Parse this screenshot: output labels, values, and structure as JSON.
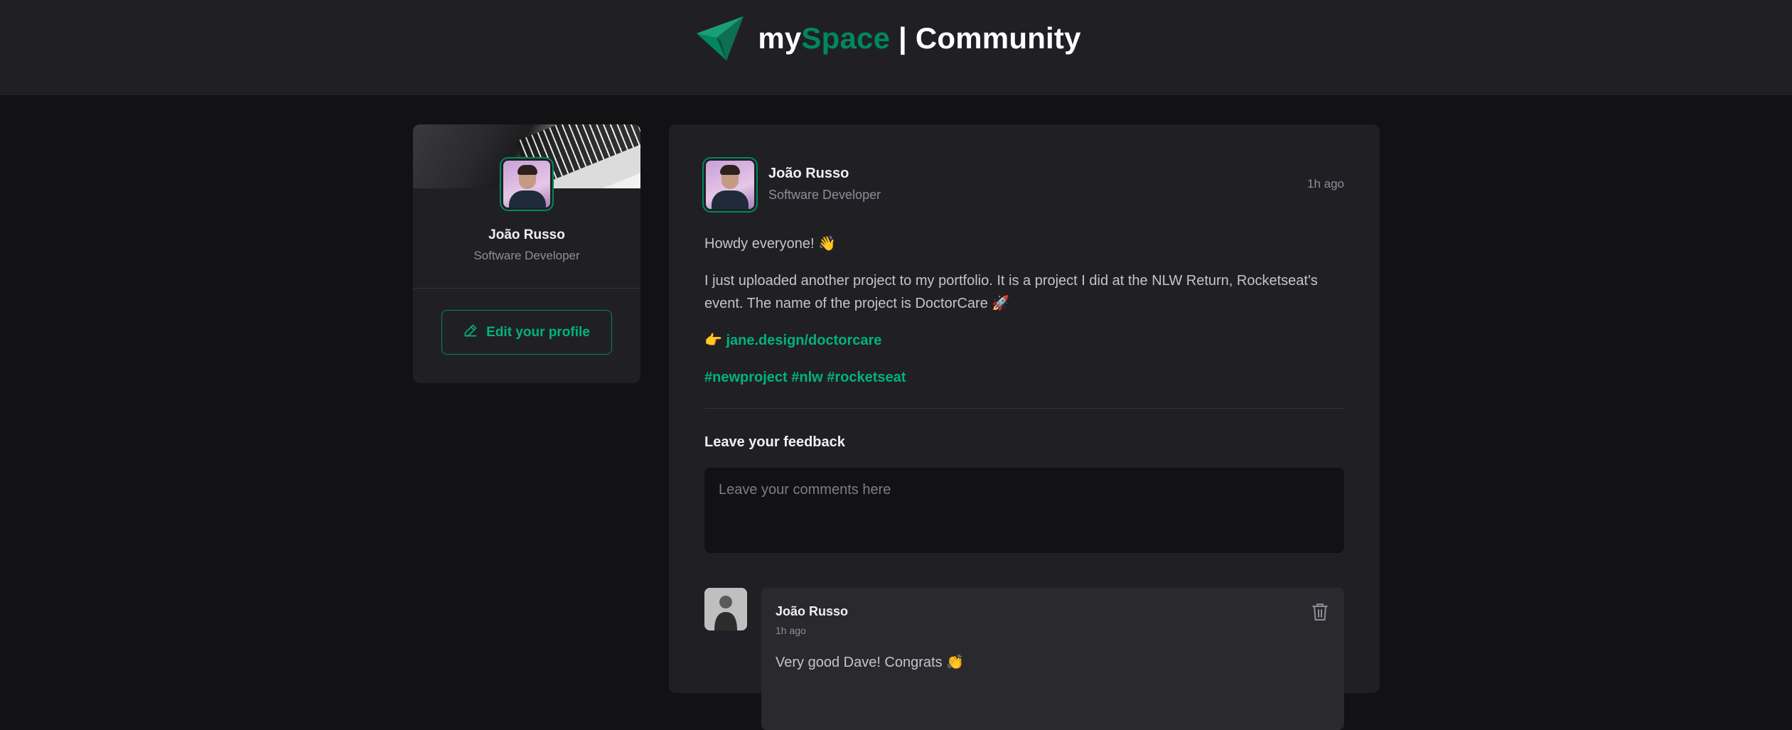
{
  "header": {
    "brand_my": "my",
    "brand_space": "Space",
    "brand_sep": " | ",
    "brand_community": "Community",
    "accent_color": "#00875f"
  },
  "sidebar": {
    "name": "João Russo",
    "role": "Software Developer",
    "edit_label": "Edit your profile",
    "edit_icon": "pencil-icon"
  },
  "post": {
    "author_name": "João Russo",
    "author_role": "Software Developer",
    "time": "1h ago",
    "line1": "Howdy everyone! 👋",
    "line2": "I just uploaded another project to my portfolio. It is a project I did at the NLW Return, Rocketseat's event. The name of the project is DoctorCare 🚀",
    "link_prefix": "👉 ",
    "link_text": "jane.design/doctorcare",
    "hashtags": "#newproject #nlw #rocketseat"
  },
  "feedback": {
    "title": "Leave your feedback",
    "placeholder": "Leave your comments here"
  },
  "comment": {
    "author": "João Russo",
    "time": "1h ago",
    "text": "Very good Dave! Congrats 👏",
    "delete_icon": "trash-icon"
  }
}
